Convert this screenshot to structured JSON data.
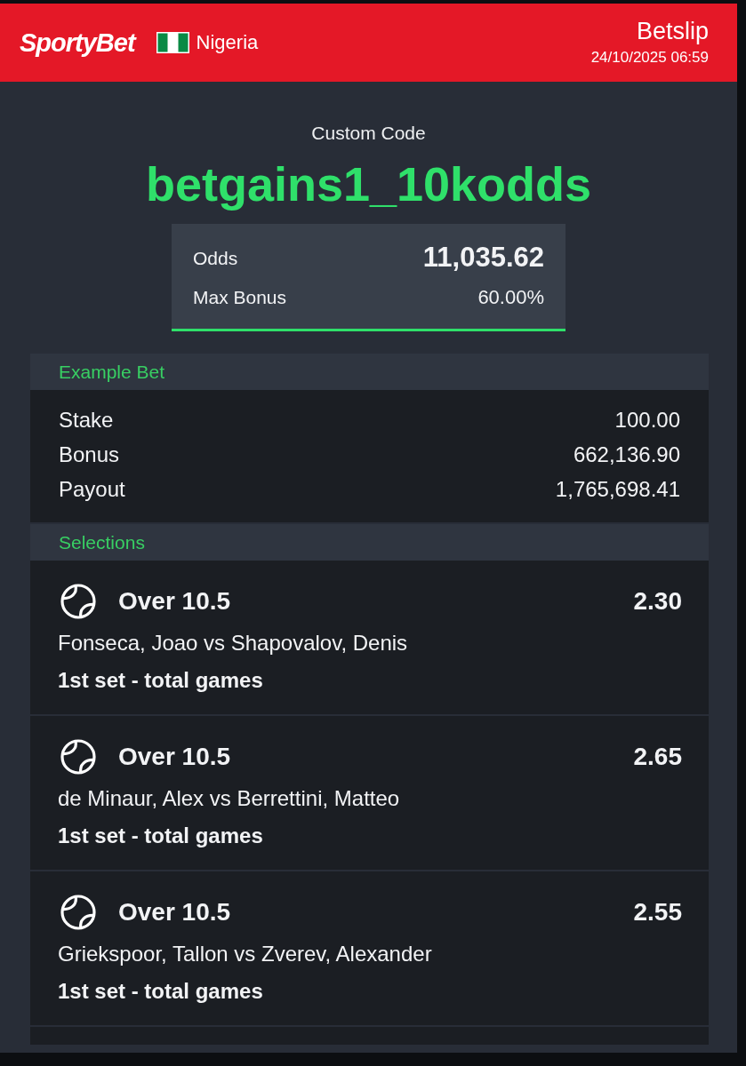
{
  "header": {
    "logo": "SportyBet",
    "country": "Nigeria",
    "title": "Betslip",
    "datetime": "24/10/2025 06:59"
  },
  "code": {
    "label": "Custom Code",
    "value": "betgains1_10kodds"
  },
  "summary": [
    {
      "kind": "emphasis",
      "label": "Odds",
      "value": "11,035.62"
    },
    {
      "kind": "plain",
      "label": "Max Bonus",
      "value": "60.00%"
    }
  ],
  "example_bet": {
    "title": "Example Bet",
    "rows": [
      {
        "label": "Stake",
        "value": "100.00"
      },
      {
        "label": "Bonus",
        "value": "662,136.90"
      },
      {
        "label": "Payout",
        "value": "1,765,698.41"
      }
    ]
  },
  "selections": {
    "title": "Selections",
    "items": [
      {
        "pick": "Over 10.5",
        "odds": "2.30",
        "match": "Fonseca, Joao vs Shapovalov, Denis",
        "market": "1st set - total games"
      },
      {
        "pick": "Over 10.5",
        "odds": "2.65",
        "match": "de Minaur, Alex vs Berrettini, Matteo",
        "market": "1st set - total games"
      },
      {
        "pick": "Over 10.5",
        "odds": "2.55",
        "match": "Griekspoor, Tallon vs Zverev, Alexander",
        "market": "1st set - total games"
      }
    ]
  }
}
